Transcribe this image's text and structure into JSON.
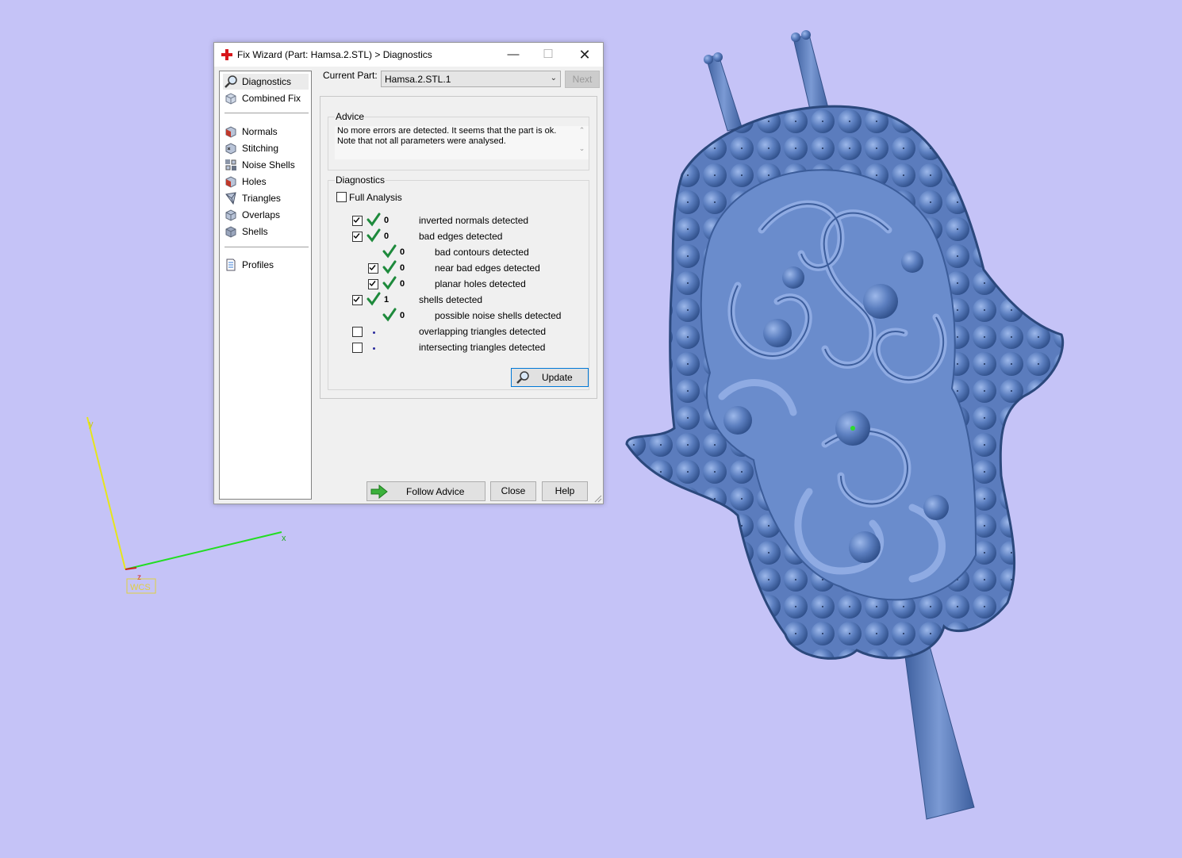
{
  "window": {
    "title": "Fix Wizard (Part: Hamsa.2.STL) > Diagnostics",
    "min_glyph": "—",
    "max_glyph": "☐",
    "close_glyph": "✕"
  },
  "nav": {
    "items": [
      {
        "label": "Diagnostics",
        "icon": "magnifier-icon",
        "selected": true
      },
      {
        "label": "Combined Fix",
        "icon": "cube-icon"
      },
      {
        "label": "Normals",
        "icon": "normals-cube-icon"
      },
      {
        "label": "Stitching",
        "icon": "stitching-cube-icon"
      },
      {
        "label": "Noise Shells",
        "icon": "noise-shells-icon"
      },
      {
        "label": "Holes",
        "icon": "holes-cube-icon"
      },
      {
        "label": "Triangles",
        "icon": "triangles-icon"
      },
      {
        "label": "Overlaps",
        "icon": "overlaps-cube-icon"
      },
      {
        "label": "Shells",
        "icon": "shells-cube-icon"
      },
      {
        "label": "Profiles",
        "icon": "document-icon"
      }
    ]
  },
  "header": {
    "current_part_label": "Current Part:",
    "current_part_value": "Hamsa.2.STL.1",
    "next_label": "Next"
  },
  "advice": {
    "group_label": "Advice",
    "text_line1": "No more errors are detected. It seems that the part is ok.",
    "text_line2": "Note that not all parameters were analysed."
  },
  "diagnostics": {
    "group_label": "Diagnostics",
    "full_analysis_label": "Full Analysis",
    "full_analysis_checked": false,
    "rows": [
      {
        "label": "inverted normals detected",
        "count": "0",
        "checked": true,
        "status": "ok"
      },
      {
        "label": "bad edges detected",
        "count": "0",
        "checked": true,
        "status": "ok"
      },
      {
        "label": "bad contours detected",
        "count": "0",
        "status": "ok"
      },
      {
        "label": "near bad edges detected",
        "count": "0",
        "checked": true,
        "status": "ok"
      },
      {
        "label": "planar holes detected",
        "count": "0",
        "checked": true,
        "status": "ok"
      },
      {
        "label": "shells detected",
        "count": "1",
        "checked": true,
        "status": "ok"
      },
      {
        "label": "possible noise shells detected",
        "count": "0",
        "status": "ok"
      },
      {
        "label": "overlapping triangles detected",
        "checked": false,
        "status": "not-analysed"
      },
      {
        "label": "intersecting triangles detected",
        "checked": false,
        "status": "not-analysed"
      }
    ],
    "update_label": "Update"
  },
  "footer": {
    "follow_advice_label": "Follow Advice",
    "close_label": "Close",
    "help_label": "Help"
  },
  "axes": {
    "x_label": "x",
    "y_label": "y",
    "z_label": "z",
    "wcs_label": "WCS"
  },
  "colors": {
    "background": "#c5c3f7",
    "model": "#5578b8",
    "model_dark": "#3a5a95",
    "ok_check": "#1e8a3c",
    "x_axis": "#22dd22",
    "y_axis": "#e6e61a"
  }
}
